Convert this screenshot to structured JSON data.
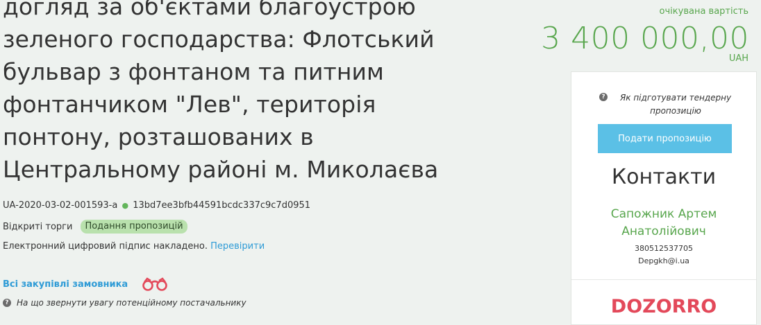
{
  "tender": {
    "title": "догляд за об'єктами благоустрою\nзеленого господарства: Флотський\nбульвар з фонтаном та питним\nфонтанчиком \"Лев\", територія\nпонтону, розташованих в\nЦентральному районі м. Миколаєва",
    "tender_id": "UA-2020-03-02-001593-a",
    "id_separator": "●",
    "hash": "13bd7ee3bfb44591bcdc337c9c7d0951",
    "procedure": "Відкриті торги",
    "status": "Подання пропозицій",
    "signature_text": "Електронний цифровий підпис накладено.",
    "signature_link": "Перевірити",
    "buyer_link": "Всі закупівлі замовника",
    "attention_text": "На що звернути увагу потенційному постачальнику"
  },
  "price": {
    "label": "очікувана вартість",
    "amount": "3 400 000,00",
    "currency": "UAH"
  },
  "panel": {
    "howto_text": "Як підготувати тендерну пропозицію",
    "submit_label": "Подати пропозицію",
    "contacts_title": "Контакти",
    "contact_name": "Сапожник Артем Анатолійович",
    "contact_phone": "380512537705",
    "contact_email": "Depgkh@i.ua",
    "logo_text": "DOZORRO"
  },
  "icons": {
    "question": "question-circle-icon",
    "binoculars": "binoculars-icon"
  },
  "colors": {
    "accent_green": "#58a64d",
    "link_blue": "#2e9bd6",
    "button_blue": "#5bc0e6",
    "badge_green": "#b9e1ad",
    "logo_red": "#e3495a"
  }
}
